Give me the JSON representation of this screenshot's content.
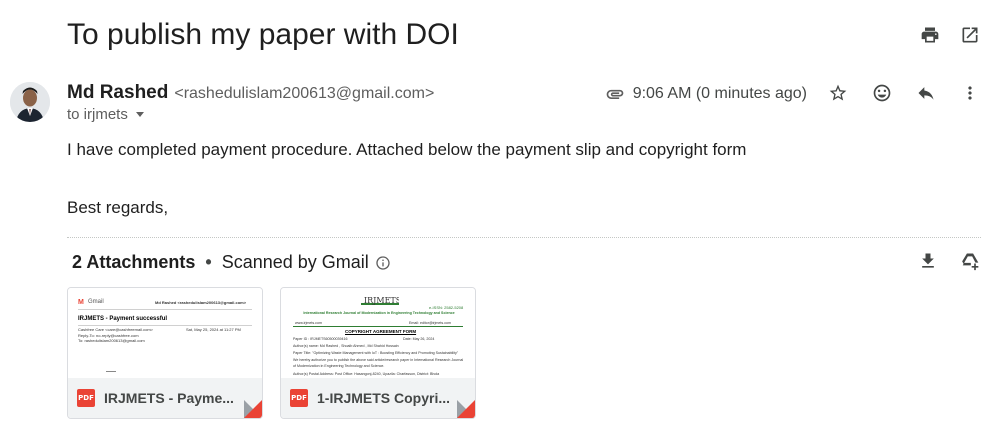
{
  "email": {
    "subject": "To publish my paper with DOI",
    "sender_name": "Md Rashed",
    "sender_email": "<rashedulislam200613@gmail.com>",
    "to_label": "to irjmets",
    "time": "9:06 AM (0 minutes ago)",
    "body_line1": "I have completed payment procedure. Attached below the payment slip and copyright form",
    "body_line2": "Best regards,"
  },
  "attachments": {
    "count_label": "2 Attachments",
    "separator": "•",
    "scanned_label": "Scanned by Gmail",
    "items": [
      {
        "name": "IRJMETS - Payme...",
        "type": "PDF",
        "preview": {
          "header_left": "Gmail",
          "header_right": "Md Rashed <rashedulislam200613@gmail.com>",
          "title": "IRJMETS - Payment successful",
          "from_line": "Cashfree Care <care@cashfreemail.com>",
          "date_line": "Sat, May 25, 2024 at 11:27 PM",
          "reply_line": "Reply-To: no-reply@cashfree.com",
          "to_line": "To: rashedulislam200613@gmail.com"
        }
      },
      {
        "name": "1-IRJMETS Copyri...",
        "type": "PDF",
        "preview": {
          "logo": "IRJMETS",
          "phone": "e-ISSN: 2582-5208",
          "journal": "International Research Journal of Modernization in Engineering Technology and Science",
          "website": "www.irjmets.com",
          "email": "Email: editor@irjmets.com",
          "title": "COPYRIGHT AGREEMENT FORM",
          "paper_id": "Paper ID : IRJMETS60500039416",
          "date": "Date: May 26, 2024",
          "authors": "Author(s) name: Md Rashed , Shoaib Ahmed , Md Shahid Hossain",
          "paper_title": "Paper Title: \"Optimizing Waste Management with IoT : Boosting Efficiency and Promoting Sustainability\"",
          "line5": "We hereby authorize you to publish the above said article/research paper in International Research Journal",
          "line6": "of Modernization in Engineering Technology and Science.",
          "line7": "Author(s) Postal Address: Post Office: Hasangonj-8240, Upazila: Charfasson, District: Bhola"
        }
      }
    ]
  },
  "colors": {
    "pdf_red": "#ea4335",
    "text": "#1f1f1f",
    "muted": "#5e5e5e"
  },
  "icons": [
    "print-icon",
    "open-new-window-icon",
    "attachment-clip-icon",
    "star-icon",
    "emoji-icon",
    "reply-icon",
    "more-vert-icon",
    "info-icon",
    "download-all-icon",
    "add-to-drive-icon",
    "pdf-icon"
  ]
}
